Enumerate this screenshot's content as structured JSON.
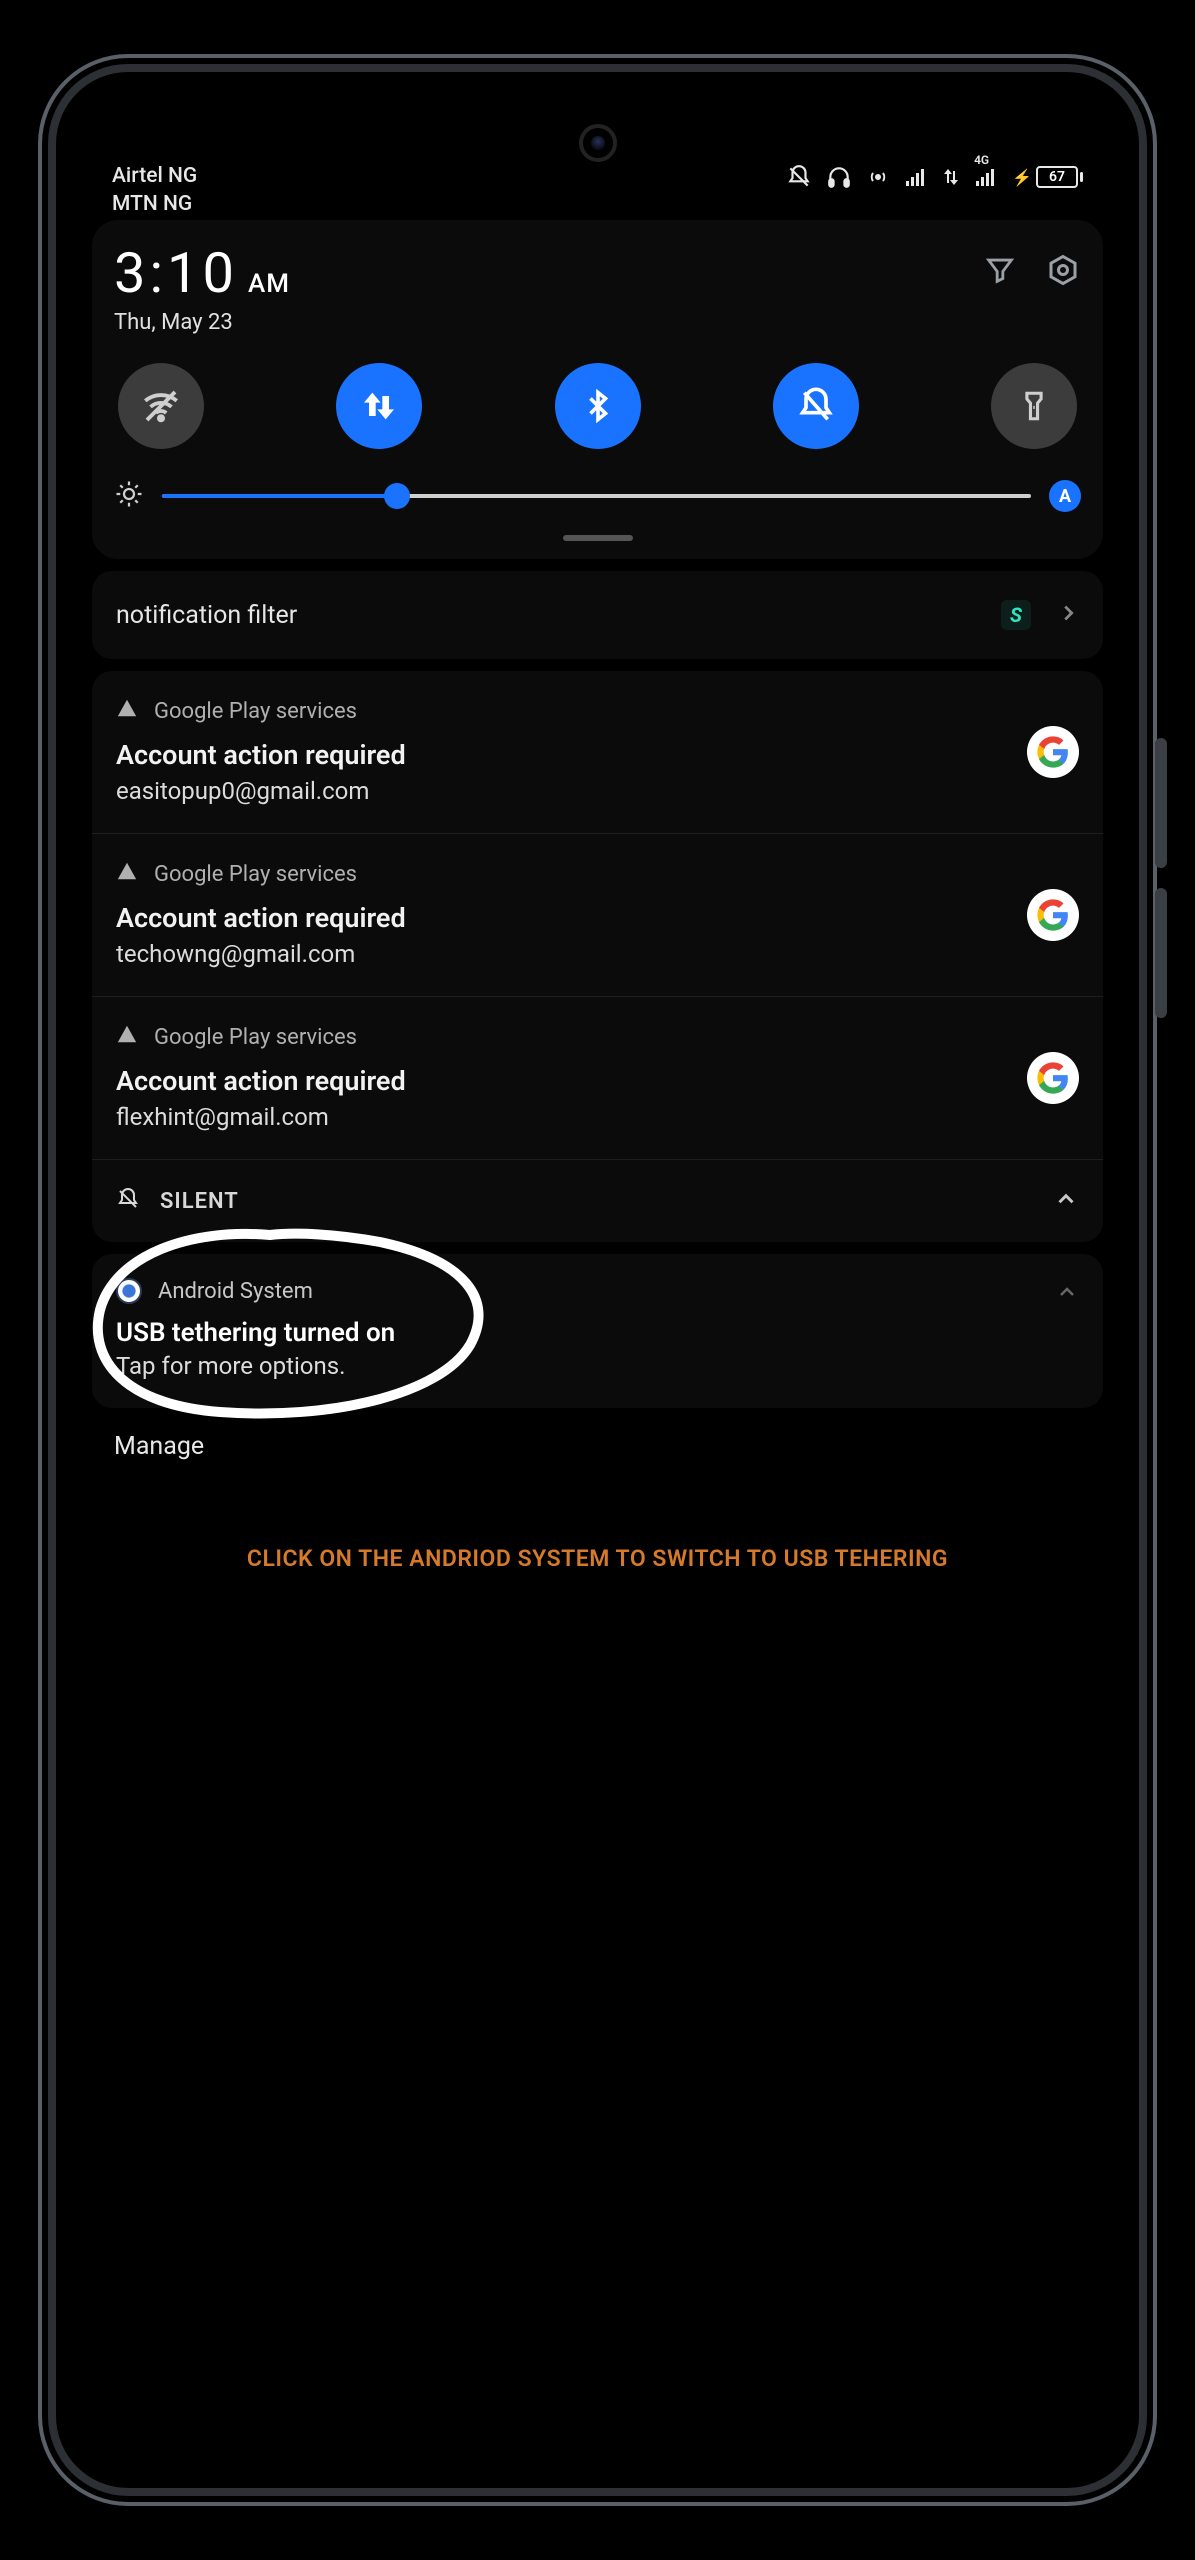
{
  "status": {
    "carrier1": "Airtel NG",
    "carrier2": "MTN NG",
    "signal_label": "4G",
    "battery": "67"
  },
  "clock": {
    "time": "3:10",
    "ampm": "AM",
    "date": "Thu, May 23"
  },
  "qs": {
    "tiles": [
      {
        "name": "wifi",
        "active": false
      },
      {
        "name": "mobile-data",
        "active": true
      },
      {
        "name": "bluetooth",
        "active": true
      },
      {
        "name": "dnd",
        "active": true
      },
      {
        "name": "flashlight",
        "active": false
      }
    ],
    "brightness_percent": 27,
    "auto_brightness_label": "A"
  },
  "filter": {
    "label": "notification filter"
  },
  "notifications": [
    {
      "app": "Google Play services",
      "title": "Account action required",
      "subtitle": "easitopup0@gmail.com"
    },
    {
      "app": "Google Play services",
      "title": "Account action required",
      "subtitle": "techowng@gmail.com"
    },
    {
      "app": "Google Play services",
      "title": "Account action required",
      "subtitle": "flexhint@gmail.com"
    }
  ],
  "section_silent": "SILENT",
  "system_notification": {
    "app": "Android System",
    "title": "USB tethering turned on",
    "subtitle": "Tap for more options."
  },
  "manage_label": "Manage",
  "hint_text": "CLICK ON THE ANDRIOD SYSTEM TO SWITCH TO USB TEHERING"
}
